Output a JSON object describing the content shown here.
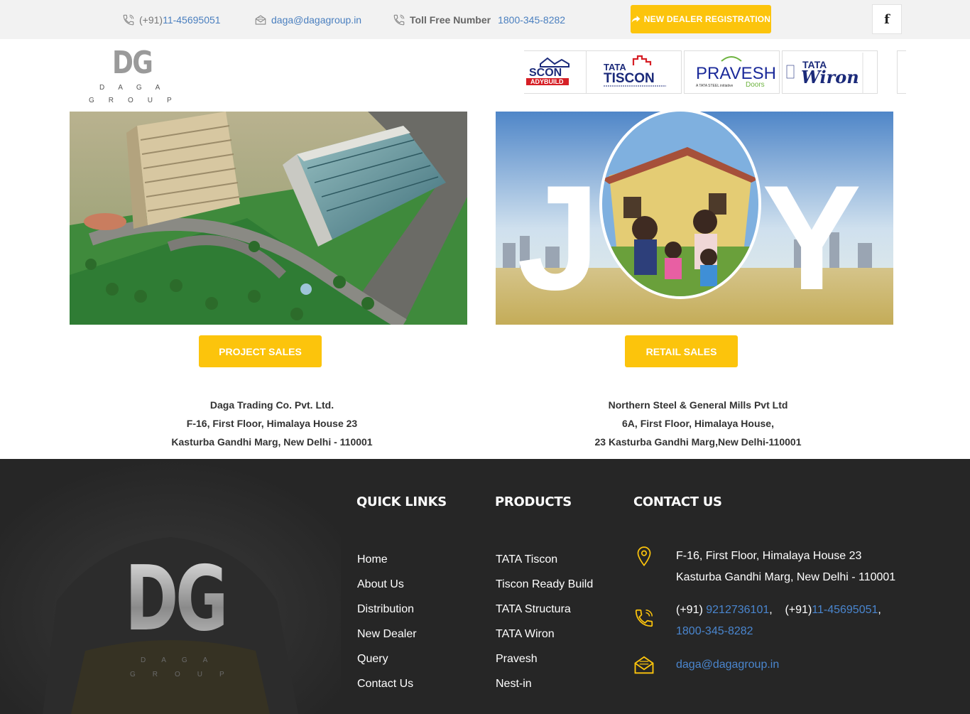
{
  "topbar": {
    "phone_prefix": "(+91)",
    "phone": "11-45695051",
    "email": "daga@dagagroup.in",
    "toll_label": "Toll Free Number",
    "toll_number": "1800-345-8282",
    "dealer_button": "NEW DEALER REGISTRATION",
    "facebook_glyph": "f"
  },
  "logo": {
    "mark": "DG",
    "line1": "DAGA",
    "line2": "GROUP"
  },
  "brands": [
    {
      "name": "TISCON READYBUILD",
      "line1": "SCON",
      "line2": "ADYBUILD"
    },
    {
      "name": "TATA TISCON",
      "line1": "TATA",
      "line2": "TISCON"
    },
    {
      "name": "PRAVESH Doors",
      "line1": "PRAVESH",
      "line2": "Doors",
      "sub": "A TATA STEEL initiative"
    },
    {
      "name": "TATA Wiron",
      "line1": "TATA",
      "line2": "Wiron"
    }
  ],
  "project": {
    "button": "PROJECT SALES",
    "company": "Daga Trading Co. Pvt. Ltd.",
    "address1": "F-16, First Floor, Himalaya House 23",
    "address2": "Kasturba Gandhi Marg, New Delhi - 110001"
  },
  "retail": {
    "button": "RETAIL SALES",
    "banner_word_left": "J",
    "banner_word_right": "Y",
    "company": "Northern Steel & General Mills Pvt Ltd",
    "address1": "6A, First Floor, Himalaya House,",
    "address2": "23 Kasturba Gandhi Marg,New Delhi-110001"
  },
  "footer": {
    "logo_mark": "DG",
    "logo_line1": "DAGA",
    "logo_line2": "GROUP",
    "quick_title": "QUICK LINKS",
    "quick_links": [
      "Home",
      "About Us",
      "Distribution",
      "New Dealer",
      "Query",
      "Contact Us"
    ],
    "products_title": "PRODUCTS",
    "products": [
      "TATA Tiscon",
      "Tiscon Ready Build",
      "TATA Structura",
      "TATA Wiron",
      "Pravesh",
      "Nest-in"
    ],
    "contact_title": "CONTACT US",
    "contact_address1": "F-16, First Floor, Himalaya House 23",
    "contact_address2": "Kasturba Gandhi Marg, New Delhi - 110001",
    "contact_phone_prefix1": "(+91) ",
    "contact_phone1": "9212736101",
    "contact_phone_prefix2": "(+91)",
    "contact_phone2": "11-45695051",
    "contact_toll": "1800-345-8282",
    "contact_email": "daga@dagagroup.in"
  },
  "colors": {
    "accent_yellow": "#fcc40c",
    "link_blue": "#4a7fbf",
    "footer_bg": "#262626"
  },
  "icons": [
    "phone-icon",
    "mail-icon",
    "share-icon",
    "facebook-icon",
    "location-icon"
  ]
}
